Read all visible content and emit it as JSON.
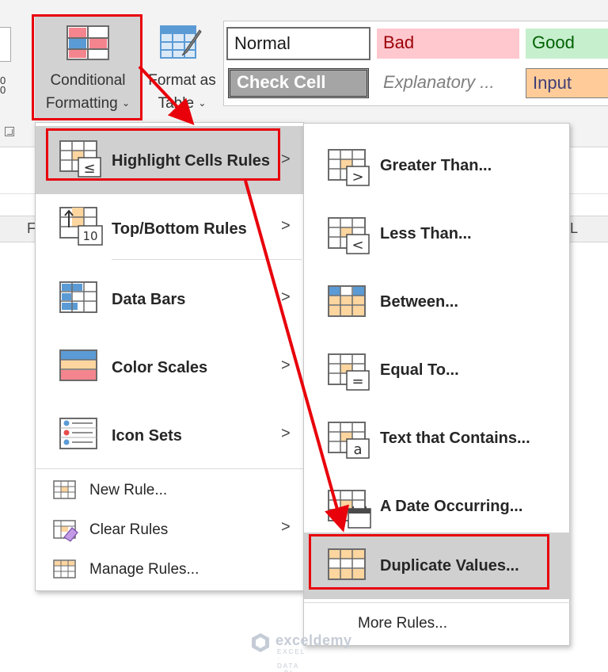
{
  "ribbon": {
    "left_digits": "0\n0",
    "conditional_formatting": {
      "line1": "Conditional",
      "line2": "Formatting",
      "chevron": "⌄"
    },
    "format_as_table": {
      "line1": "Format as",
      "line2": "Table",
      "chevron": "⌄"
    },
    "cell_styles": {
      "normal": "Normal",
      "bad": "Bad",
      "good": "Good",
      "check_cell": "Check Cell",
      "explanatory": "Explanatory ...",
      "input": "Input"
    }
  },
  "sheet": {
    "col_f": "F",
    "col_l": "L"
  },
  "main_menu": {
    "items": [
      {
        "label": "Highlight Cells Rules",
        "icon": "highlight-cells-icon",
        "has_submenu": true,
        "highlighted": true
      },
      {
        "label": "Top/Bottom Rules",
        "icon": "top-bottom-icon",
        "has_submenu": true
      },
      {
        "label": "Data Bars",
        "icon": "data-bars-icon",
        "has_submenu": true
      },
      {
        "label": "Color Scales",
        "icon": "color-scales-icon",
        "has_submenu": true
      },
      {
        "label": "Icon Sets",
        "icon": "icon-sets-icon",
        "has_submenu": true
      }
    ],
    "small_items": [
      {
        "label": "New Rule...",
        "icon": "new-rule-icon"
      },
      {
        "label": "Clear Rules",
        "icon": "clear-rules-icon",
        "has_submenu": true
      },
      {
        "label": "Manage Rules...",
        "icon": "manage-rules-icon"
      }
    ],
    "arrow_glyph": ">"
  },
  "sub_menu": {
    "items": [
      {
        "label": "Greater Than...",
        "icon": "greater-than-icon",
        "glyph": ">"
      },
      {
        "label": "Less Than...",
        "icon": "less-than-icon",
        "glyph": "<"
      },
      {
        "label": "Between...",
        "icon": "between-icon"
      },
      {
        "label": "Equal To...",
        "icon": "equal-to-icon",
        "glyph": "="
      },
      {
        "label": "Text that Contains...",
        "icon": "text-contains-icon",
        "glyph": "a"
      },
      {
        "label": "A Date Occurring...",
        "icon": "date-occurring-icon"
      },
      {
        "label": "Duplicate Values...",
        "icon": "duplicate-values-icon",
        "highlighted": true
      }
    ],
    "more_rules": "More Rules..."
  },
  "icon_glyphs": {
    "less_equal": "≤",
    "ten": "10"
  },
  "watermark": {
    "name": "exceldemy",
    "tagline": "EXCEL · DATA · BI"
  },
  "colors": {
    "annotation_red": "#e8000b",
    "highlight_gray": "#d0d0d0",
    "orange_cell": "#fcd59f",
    "blue_cell": "#5b9bd5"
  }
}
